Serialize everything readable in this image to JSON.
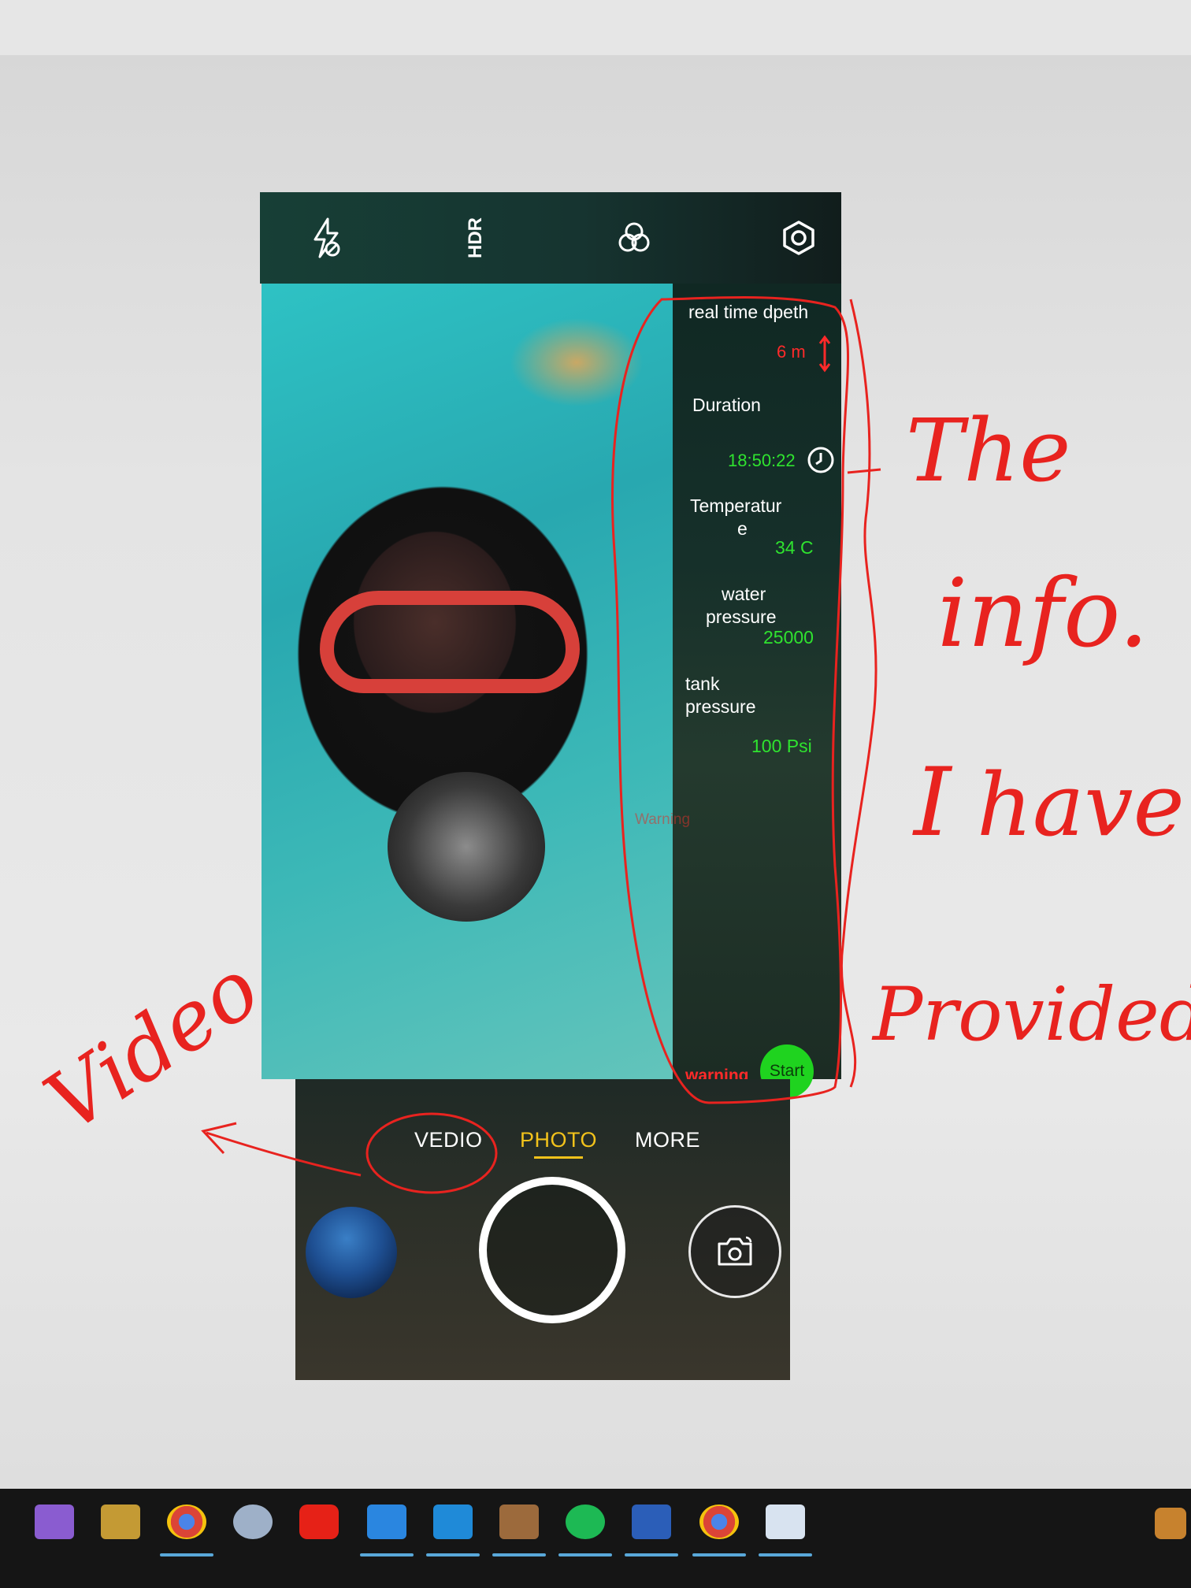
{
  "camera": {
    "topbar": {
      "icons": [
        "flash-off-icon",
        "hdr-icon",
        "filters-icon",
        "settings-icon"
      ],
      "hdr_label": "HDR"
    },
    "info_panel": {
      "depth_label": "real time dpeth",
      "depth_value": "6 m",
      "duration_label": "Duration",
      "duration_value": "18:50:22",
      "temperature_label_line1": "Temperatur",
      "temperature_label_line2": "e",
      "temperature_value": "34 C",
      "water_pressure_label_line1": "water",
      "water_pressure_label_line2": "pressure",
      "water_pressure_value": "25000",
      "tank_pressure_label_line1": "tank",
      "tank_pressure_label_line2": "pressure",
      "tank_pressure_value": "100 Psi",
      "faded_warning": "Warning",
      "warning_label": "warning",
      "start_button": "Start"
    },
    "modes": {
      "video": "VEDIO",
      "photo": "PHOTO",
      "more": "MORE",
      "active": "PHOTO"
    },
    "colors": {
      "active_mode": "#f2c21b",
      "value_green": "#2fe32f",
      "value_red": "#ff2a2a",
      "start_button": "#1fd31f"
    }
  },
  "annotations": {
    "the_info_line1": "The",
    "the_info_line2": "info.",
    "i_have_line1": "I",
    "i_have_line2": "have",
    "provided": "Provided",
    "video": "Video",
    "color": "#e8231f"
  },
  "taskbar": {
    "apps": [
      "visual-studio",
      "snipping-tool",
      "chrome",
      "paint",
      "youtube",
      "bing",
      "vscode",
      "minecraft",
      "spotify",
      "word",
      "chrome-profile",
      "xaml-tool"
    ],
    "tray": "notification-app"
  }
}
